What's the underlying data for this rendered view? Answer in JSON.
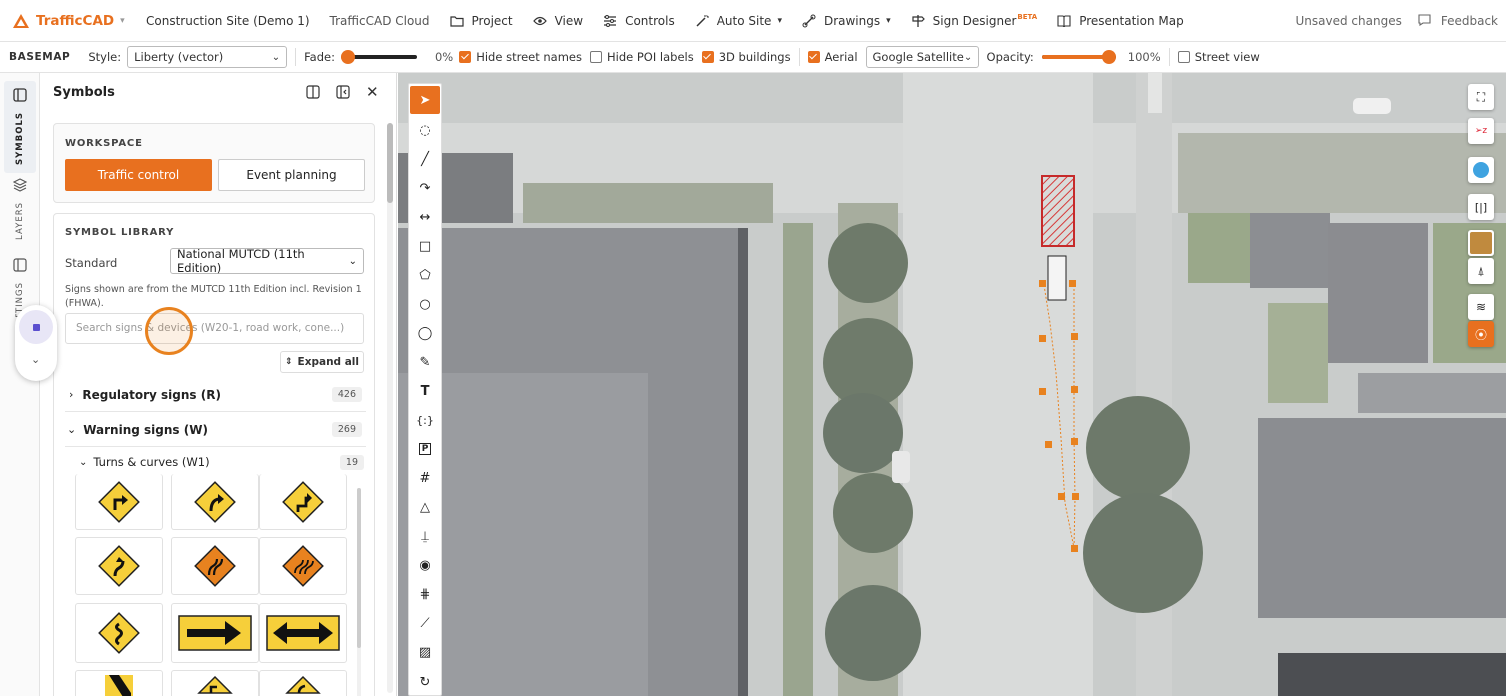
{
  "topbar": {
    "brand": "TrafficCAD",
    "project_name": "Construction Site (Demo 1)",
    "cloud": "TrafficCAD Cloud",
    "nav": [
      {
        "label": "Project",
        "icon": "folder-icon"
      },
      {
        "label": "View",
        "icon": "eye-icon"
      },
      {
        "label": "Controls",
        "icon": "sliders-icon"
      },
      {
        "label": "Auto Site",
        "icon": "magic-wand-icon"
      },
      {
        "label": "Drawings",
        "icon": "drawings-icon"
      },
      {
        "label": "Sign Designer",
        "icon": "signpost-icon",
        "badge": "BETA"
      },
      {
        "label": "Presentation Map",
        "icon": "book-icon"
      }
    ],
    "unsaved": "Unsaved changes",
    "feedback": "Feedback"
  },
  "basemap": {
    "section": "BASEMAP",
    "style_label": "Style:",
    "style_value": "Liberty (vector)",
    "fade_label": "Fade:",
    "fade_value": "0%",
    "fade_fraction": 0.0,
    "hide_street_names": "Hide street names",
    "hide_street_names_checked": true,
    "hide_poi": "Hide POI labels",
    "hide_poi_checked": false,
    "buildings": "3D buildings",
    "buildings_checked": true,
    "aerial": "Aerial",
    "aerial_checked": true,
    "aerial_source": "Google Satellite",
    "opacity_label": "Opacity:",
    "opacity_value": "100%",
    "opacity_fraction": 1.0,
    "street_view": "Street view",
    "street_view_checked": false
  },
  "rail": {
    "symbols": "SYMBOLS",
    "layers": "LAYERS",
    "settings": "SETTINGS"
  },
  "panel": {
    "title": "Symbols",
    "workspace_label": "WORKSPACE",
    "workspace_active": "Traffic control",
    "workspace_other": "Event planning",
    "library_label": "SYMBOL LIBRARY",
    "standard_label": "Standard",
    "standard_value": "National MUTCD (11th Edition)",
    "note": "Signs shown are from the MUTCD 11th Edition incl. Revision 1 (FHWA).",
    "search_placeholder": "Search signs & devices (W20-1, road work, cone...)",
    "expand_all": "Expand all",
    "categories": [
      {
        "label": "Regulatory signs (R)",
        "count": "426",
        "expanded": false
      },
      {
        "label": "Warning signs (W)",
        "count": "269",
        "expanded": true
      }
    ],
    "subcategory": {
      "label": "Turns & curves (W1)",
      "count": "19"
    }
  },
  "colors": {
    "accent": "#e8701f",
    "sign_yellow": "#f6cf3a",
    "sign_orange": "#e8821f"
  }
}
